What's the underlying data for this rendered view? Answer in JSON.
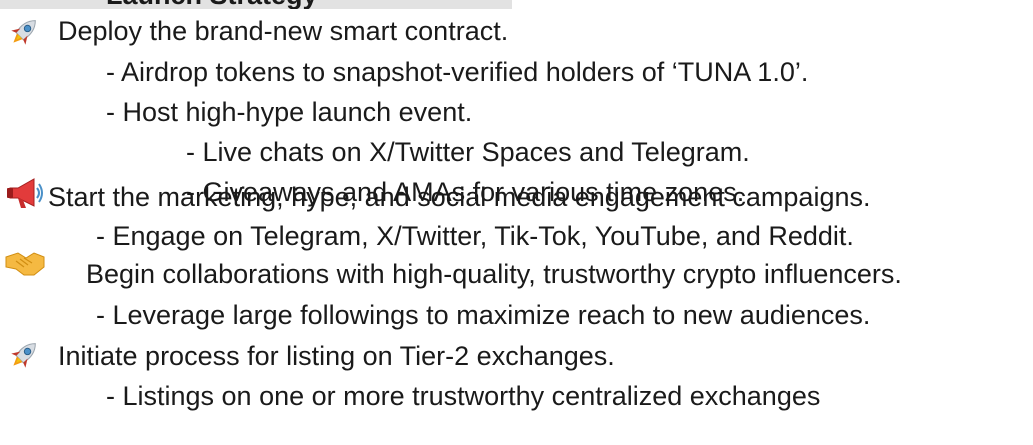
{
  "heading_partial": "Launch Strategy",
  "icons": [
    "rocket-icon",
    "megaphone-icon",
    "handshake-icon",
    "rocket-icon"
  ],
  "lines": [
    "Deploy the brand-new smart contract.",
    "- Airdrop tokens to snapshot-verified holders of ‘TUNA 1.0’.",
    "- Host high-hype launch event.",
    "- Live chats on X/Twitter Spaces and Telegram.",
    "- Giveaways and AMAs for various time zones.",
    "Start the marketing, hype, and social media engagement campaigns.",
    "- Engage on Telegram, X/Twitter, Tik-Tok, YouTube, and Reddit.",
    "Begin collaborations with high-quality, trustworthy crypto influencers.",
    "- Leverage large followings to maximize reach to new audiences.",
    "Initiate process for listing on Tier-2 exchanges.",
    "- Listings on one or more trustworthy centralized exchanges"
  ]
}
